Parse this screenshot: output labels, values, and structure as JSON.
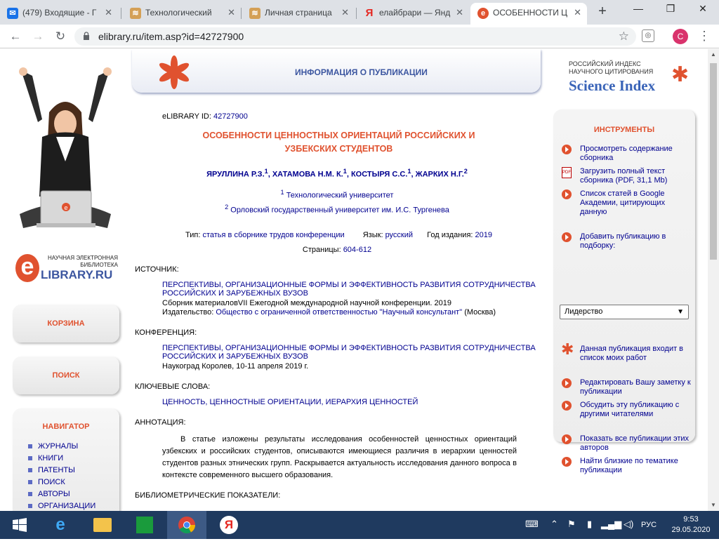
{
  "browser": {
    "tabs": [
      {
        "label": "(479) Входящие - Г",
        "icon": "mail-icon",
        "color": "#1a73e8"
      },
      {
        "label": "Технологический",
        "icon": "site-icon",
        "color": "#d4a056"
      },
      {
        "label": "Личная страница",
        "icon": "site-icon",
        "color": "#d4a056"
      },
      {
        "label": "елайбрари — Янд",
        "icon": "yandex-icon",
        "color": "#e52620"
      },
      {
        "label": "ОСОБЕННОСТИ Ц",
        "icon": "elibrary-icon",
        "color": "#e0522f"
      }
    ],
    "new_tab": "+",
    "url": "elibrary.ru/item.asp?id=42727900",
    "profile_initial": "C"
  },
  "left": {
    "logo_line1": "НАУЧНАЯ ЭЛЕКТРОННАЯ",
    "logo_line2": "БИБЛИОТЕКА",
    "logo_main": "LIBRARY.RU",
    "logo_letter": "e",
    "cart_label": "КОРЗИНА",
    "search_label": "ПОИСК",
    "navigator_title": "НАВИГАТОР",
    "nav_items": [
      "ЖУРНАЛЫ",
      "КНИГИ",
      "ПАТЕНТЫ",
      "ПОИСК",
      "АВТОРЫ",
      "ОРГАНИЗАЦИИ"
    ]
  },
  "header": {
    "title": "ИНФОРМАЦИЯ О ПУБЛИКАЦИИ",
    "si_line1": "РОССИЙСКИЙ ИНДЕКС",
    "si_line2": "НАУЧНОГО ЦИТИРОВАНИЯ",
    "si_main": "Science Index"
  },
  "publication": {
    "id_label": "eLIBRARY ID:",
    "id_value": "42727900",
    "title_line1": "ОСОБЕННОСТИ ЦЕННОСТНЫХ ОРИЕНТАЦИЙ РОССИЙСКИХ И",
    "title_line2": "УЗБЕКСКИХ СТУДЕНТОВ",
    "authors": [
      {
        "name": "ЯРУЛЛИНА Р.З.",
        "sup": "1"
      },
      {
        "name": "ХАТАМОВА Н.М. К.",
        "sup": "1"
      },
      {
        "name": "КОСТЫРЯ С.С.",
        "sup": "1"
      },
      {
        "name": "ЖАРКИХ Н.Г.",
        "sup": "2"
      }
    ],
    "affiliations": [
      {
        "sup": "1",
        "name": "Технологический университет"
      },
      {
        "sup": "2",
        "name": "Орловский государственный университет им. И.С. Тургенева"
      }
    ],
    "type_label": "Тип:",
    "type_value": "статья в сборнике трудов конференции",
    "lang_label": "Язык:",
    "lang_value": "русский",
    "year_label": "Год издания:",
    "year_value": "2019",
    "pages_label": "Страницы:",
    "pages_value": "604-612",
    "source_label": "ИСТОЧНИК:",
    "source_title_line1": "ПЕРСПЕКТИВЫ, ОРГАНИЗАЦИОННЫЕ ФОРМЫ И ЭФФЕКТИВНОСТЬ РАЗВИТИЯ СОТРУДНИЧЕСТВА",
    "source_title_line2": "РОССИЙСКИХ И ЗАРУБЕЖНЫХ ВУЗОВ",
    "source_collection": "Сборник материаловVII Ежегодной международной научной конференции. 2019",
    "publisher_label": "Издательство:",
    "publisher_value": "Общество с ограниченной ответственностью \"Научный консультант\"",
    "publisher_city": "(Москва)",
    "conf_label": "КОНФЕРЕНЦИЯ:",
    "conf_title_line1": "ПЕРСПЕКТИВЫ, ОРГАНИЗАЦИОННЫЕ ФОРМЫ И ЭФФЕКТИВНОСТЬ РАЗВИТИЯ СОТРУДНИЧЕСТВА",
    "conf_title_line2": "РОССИЙСКИХ И ЗАРУБЕЖНЫХ ВУЗОВ",
    "conf_place": "Наукоград Королев, 10-11 апреля 2019 г.",
    "keywords_label": "КЛЮЧЕВЫЕ СЛОВА:",
    "keywords": "ЦЕННОСТЬ, ЦЕННОСТНЫЕ ОРИЕНТАЦИИ, ИЕРАРХИЯ ЦЕННОСТЕЙ",
    "annotation_label": "АННОТАЦИЯ:",
    "annotation": "В статье изложены результаты исследования особенностей ценностных ориентаций узбекских и российских студентов, описываются имеющиеся различия в иерархии ценностей студентов разных этнических групп. Раскрывается актуальность исследования данного вопроса в контексте современного высшего образования.",
    "biblio_label": "БИБЛИОМЕТРИЧЕСКИЕ ПОКАЗАТЕЛИ:"
  },
  "tools": {
    "title": "ИНСТРУМЕНТЫ",
    "items": [
      "Просмотреть содержание сборника",
      "Загрузить полный текст сборника (PDF, 31,1 Mb)",
      "Список статей в Google Академии, цитирующих данную",
      "Добавить публикацию в подборку:",
      "Данная публикация входит в список моих работ",
      "Редактировать Вашу заметку к публикации",
      "Обсудить эту публикацию с другими читателями",
      "Показать все публикации этих авторов",
      "Найти близкие по тематике публикации"
    ],
    "select_value": "Лидерство"
  },
  "taskbar": {
    "lang": "РУС",
    "time": "9:53",
    "date": "29.05.2020"
  },
  "colors": {
    "accent": "#e0522f",
    "link": "#00008f",
    "header_blue": "#3c56a0"
  }
}
